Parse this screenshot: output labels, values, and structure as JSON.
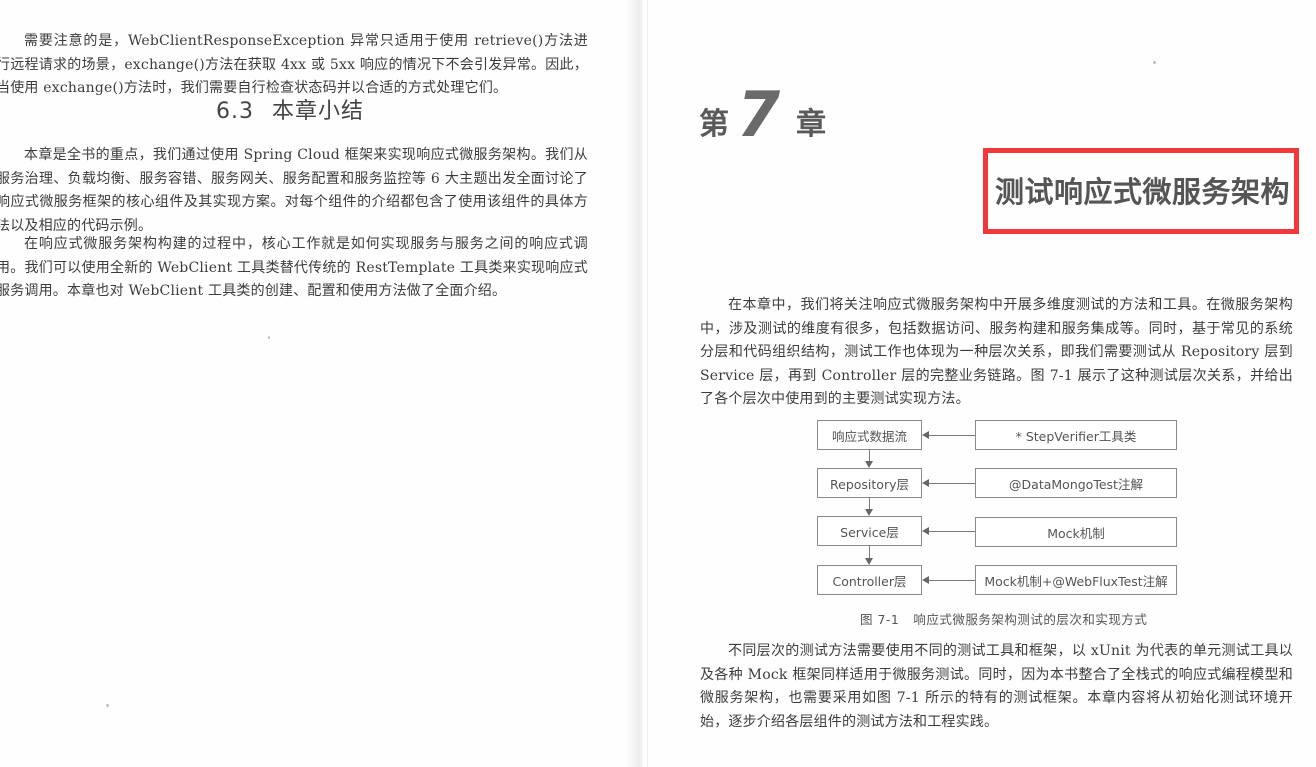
{
  "left_page": {
    "paragraph_top": "需要注意的是，WebClientResponseException 异常只适用于使用 retrieve()方法进行远程请求的场景，exchange()方法在获取 4xx 或 5xx 响应的情况下不会引发异常。因此，当使用 exchange()方法时，我们需要自行检查状态码并以合适的方式处理它们。",
    "section": {
      "number": "6.3",
      "title": "本章小结"
    },
    "paragraphs": [
      "本章是全书的重点，我们通过使用 Spring Cloud 框架来实现响应式微服务架构。我们从服务治理、负载均衡、服务容错、服务网关、服务配置和服务监控等 6 大主题出发全面讨论了响应式微服务框架的核心组件及其实现方案。对每个组件的介绍都包含了使用该组件的具体方法以及相应的代码示例。",
      "在响应式微服务架构构建的过程中，核心工作就是如何实现服务与服务之间的响应式调用。我们可以使用全新的 WebClient 工具类替代传统的 RestTemplate 工具类来实现响应式服务调用。本章也对 WebClient 工具类的创建、配置和使用方法做了全面介绍。"
    ]
  },
  "right_page": {
    "chapter": {
      "prefix": "第",
      "number": "7",
      "suffix": "章",
      "title": "测试响应式微服务架构",
      "highlight_color": "#f2383a"
    },
    "paragraphs": [
      "在本章中，我们将关注响应式微服务架构中开展多维度测试的方法和工具。在微服务架构中，涉及测试的维度有很多，包括数据访问、服务构建和服务集成等。同时，基于常见的系统分层和代码组织结构，测试工作也体现为一种层次关系，即我们需要测试从 Repository 层到 Service 层，再到 Controller 层的完整业务链路。图 7-1 展示了这种测试层次关系，并给出了各个层次中使用到的主要测试实现方法。",
      "不同层次的测试方法需要使用不同的测试工具和框架，以 xUnit 为代表的单元测试工具以及各种 Mock 框架同样适用于微服务测试。同时，因为本书整合了全栈式的响应式编程模型和微服务架构，也需要采用如图 7-1 所示的特有的测试框架。本章内容将从初始化测试环境开始，逐步介绍各层组件的测试方法和工程实践。"
    ],
    "figure": {
      "layers": [
        {
          "layer": "响应式数据流",
          "method": "* StepVerifier工具类"
        },
        {
          "layer": "Repository层",
          "method": "@DataMongoTest注解"
        },
        {
          "layer": "Service层",
          "method": "Mock机制"
        },
        {
          "layer": "Controller层",
          "method": "Mock机制+@WebFluxTest注解"
        }
      ],
      "caption_number": "图 7-1",
      "caption_text": "响应式微服务架构测试的层次和实现方式"
    }
  }
}
